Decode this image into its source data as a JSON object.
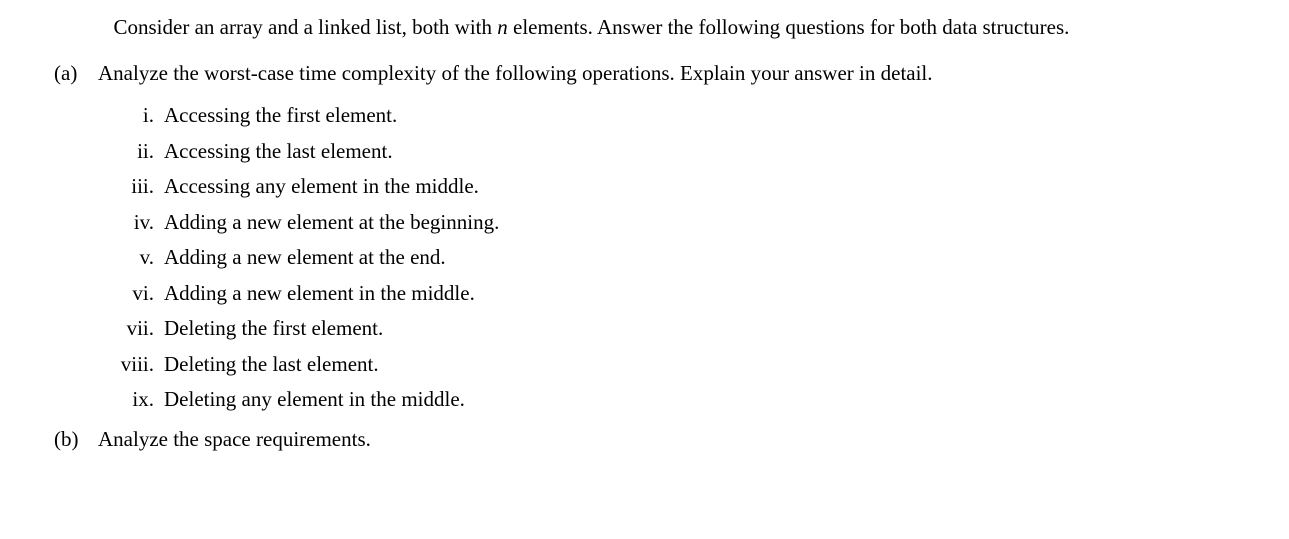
{
  "intro": {
    "prefix": "Consider an array and a linked list, both with ",
    "n": "n",
    "suffix": " elements.  Answer the following questions for both data structures."
  },
  "parts": [
    {
      "marker": "(a)",
      "text": "Analyze the worst-case time complexity of the following operations.  Explain your answer in detail.",
      "subitems": [
        {
          "marker": "i.",
          "text": "Accessing the first element."
        },
        {
          "marker": "ii.",
          "text": "Accessing the last element."
        },
        {
          "marker": "iii.",
          "text": "Accessing any element in the middle."
        },
        {
          "marker": "iv.",
          "text": "Adding a new element at the beginning."
        },
        {
          "marker": "v.",
          "text": "Adding a new element at the end."
        },
        {
          "marker": "vi.",
          "text": "Adding a new element in the middle."
        },
        {
          "marker": "vii.",
          "text": "Deleting the first element."
        },
        {
          "marker": "viii.",
          "text": "Deleting the last element."
        },
        {
          "marker": "ix.",
          "text": "Deleting any element in the middle."
        }
      ]
    },
    {
      "marker": "(b)",
      "text": "Analyze the space requirements.",
      "subitems": []
    }
  ]
}
